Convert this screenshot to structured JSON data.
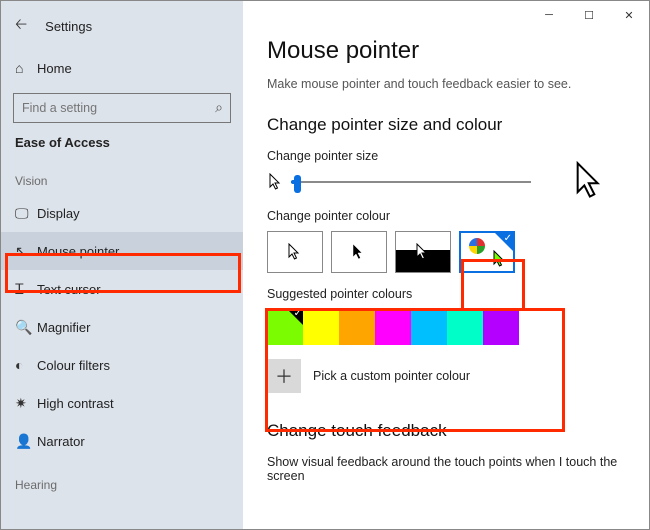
{
  "window": {
    "app_title": "Settings"
  },
  "sidebar": {
    "home": "Home",
    "search_placeholder": "Find a setting",
    "category": "Ease of Access",
    "group_vision": "Vision",
    "group_hearing": "Hearing",
    "items": [
      {
        "icon": "display-icon",
        "label": "Display"
      },
      {
        "icon": "mouse-pointer-icon",
        "label": "Mouse pointer"
      },
      {
        "icon": "text-cursor-icon",
        "label": "Text cursor"
      },
      {
        "icon": "magnifier-icon",
        "label": "Magnifier"
      },
      {
        "icon": "colour-filters-icon",
        "label": "Colour filters"
      },
      {
        "icon": "high-contrast-icon",
        "label": "High contrast"
      },
      {
        "icon": "narrator-icon",
        "label": "Narrator"
      }
    ]
  },
  "main": {
    "title": "Mouse pointer",
    "subtitle": "Make mouse pointer and touch feedback easier to see.",
    "section_size_colour": "Change pointer size and colour",
    "label_size": "Change pointer size",
    "label_colour": "Change pointer colour",
    "label_suggested": "Suggested pointer colours",
    "pick_custom": "Pick a custom pointer colour",
    "section_touch": "Change touch feedback",
    "touch_desc": "Show visual feedback around the touch points when I touch the screen",
    "swatches": [
      "#7CFC00",
      "#FFFF00",
      "#FFA500",
      "#FF00FF",
      "#00BFFF",
      "#00FFC8",
      "#B300FF"
    ]
  }
}
